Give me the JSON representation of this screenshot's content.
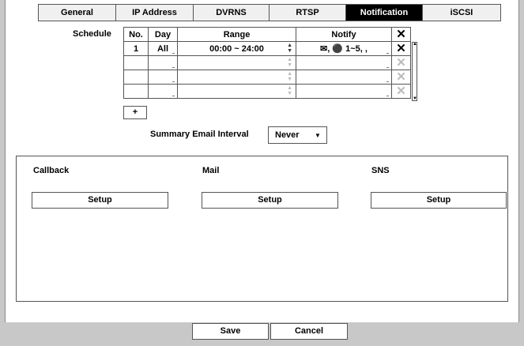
{
  "tabs": [
    "General",
    "IP Address",
    "DVRNS",
    "RTSP",
    "Notification",
    "iSCSI"
  ],
  "schedule": {
    "label": "Schedule",
    "headers": {
      "no": "No.",
      "day": "Day",
      "range": "Range",
      "notify": "Notify",
      "delete": "✕"
    },
    "rows": [
      {
        "no": "1",
        "day": "All",
        "range": "00:00 ~ 24:00",
        "notify": "✉, ⚫ 1~5, ,"
      }
    ],
    "add_label": "+"
  },
  "summary": {
    "label": "Summary Email Interval",
    "value": "Never"
  },
  "sections": [
    {
      "title": "Callback",
      "button": "Setup"
    },
    {
      "title": "Mail",
      "button": "Setup"
    },
    {
      "title": "SNS",
      "button": "Setup"
    }
  ],
  "footer": {
    "save": "Save",
    "cancel": "Cancel"
  },
  "icons": {
    "delete": "close-icon",
    "scroll_up": "arrow-up-icon",
    "scroll_down": "arrow-down-icon",
    "dropdown": "chevron-down-icon"
  }
}
